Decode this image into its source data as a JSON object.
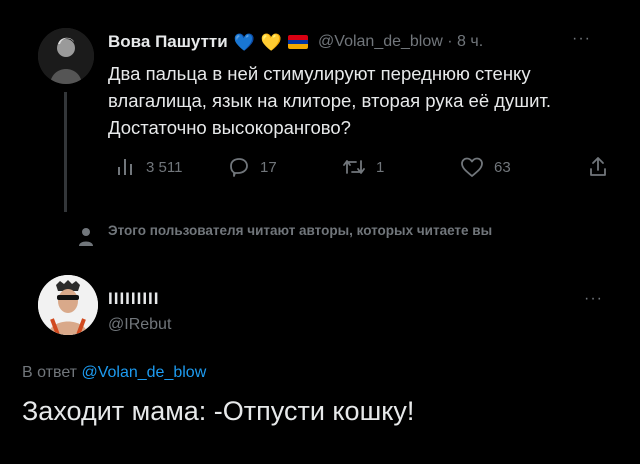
{
  "tweet": {
    "display_name": "Вова Пашутти",
    "badges": [
      "💙",
      "💛"
    ],
    "handle": "@Volan_de_blow",
    "time": "8 ч.",
    "separator": "·",
    "more": "···",
    "text": "Два пальца в ней стимулируют переднюю стенку влагалища, язык на клиторе, вторая рука её душит. Достаточно высокорангово?",
    "stats": {
      "views": "3 511",
      "replies": "17",
      "retweets": "1",
      "likes": "63"
    }
  },
  "follow_note": "Этого пользователя читают авторы, которых читаете вы",
  "reply": {
    "display_name": "IIIIIIIII",
    "handle": "@IRebut",
    "more": "···",
    "reply_prefix": "В ответ",
    "reply_to": "@Volan_de_blow",
    "text": "Заходит мама: -Отпусти кошку!"
  },
  "colors": {
    "background": "#000000",
    "text": "#e7e9ea",
    "muted": "#71767b",
    "link": "#1d9bf0",
    "flag": [
      "#d90012",
      "#0033a0",
      "#f2a800"
    ]
  },
  "icons": [
    "views-icon",
    "reply-icon",
    "retweet-icon",
    "like-icon",
    "share-icon",
    "follow-note-icon"
  ]
}
